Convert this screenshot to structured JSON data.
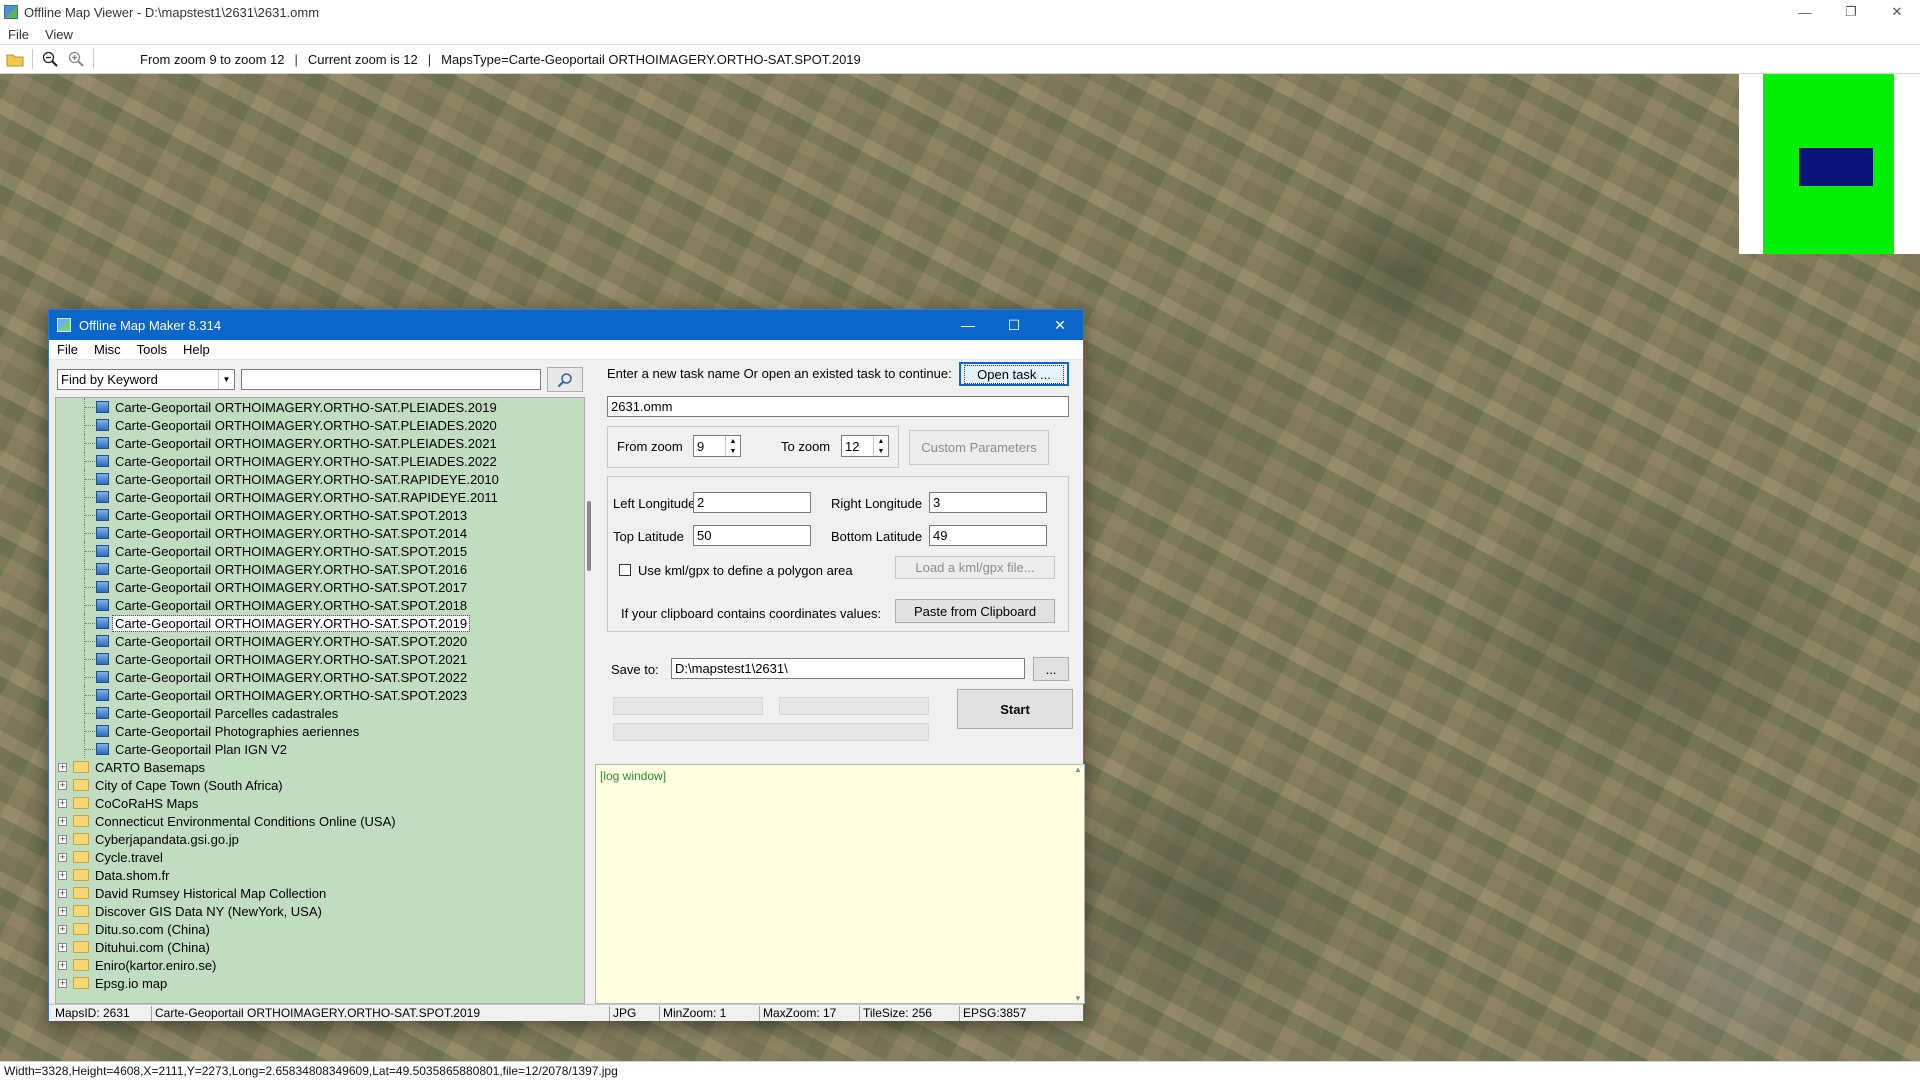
{
  "main_window": {
    "title": "Offline Map Viewer - D:\\mapstest1\\2631\\2631.omm",
    "menu": [
      "File",
      "View"
    ],
    "toolbar": {
      "zoom_range": "From zoom 9 to zoom 12",
      "current_zoom": "Current zoom is 12",
      "maps_type": "MapsType=Carte-Geoportail ORTHOIMAGERY.ORTHO-SAT.SPOT.2019",
      "separator": "|"
    },
    "status_bar": "Width=3328,Height=4608,X=2111,Y=2273,Long=2.65834808349609,Lat=49.5035865880801,file=12/2078/1397.jpg",
    "minimap_colors": {
      "background": "#00ee00",
      "viewport": "#0a1478"
    }
  },
  "dialog": {
    "title": "Offline Map Maker 8.314",
    "menu": [
      "File",
      "Misc",
      "Tools",
      "Help"
    ],
    "search_mode": "Find by Keyword",
    "search_value": "",
    "tree_children": [
      "Carte-Geoportail ORTHOIMAGERY.ORTHO-SAT.PLEIADES.2019",
      "Carte-Geoportail ORTHOIMAGERY.ORTHO-SAT.PLEIADES.2020",
      "Carte-Geoportail ORTHOIMAGERY.ORTHO-SAT.PLEIADES.2021",
      "Carte-Geoportail ORTHOIMAGERY.ORTHO-SAT.PLEIADES.2022",
      "Carte-Geoportail ORTHOIMAGERY.ORTHO-SAT.RAPIDEYE.2010",
      "Carte-Geoportail ORTHOIMAGERY.ORTHO-SAT.RAPIDEYE.2011",
      "Carte-Geoportail ORTHOIMAGERY.ORTHO-SAT.SPOT.2013",
      "Carte-Geoportail ORTHOIMAGERY.ORTHO-SAT.SPOT.2014",
      "Carte-Geoportail ORTHOIMAGERY.ORTHO-SAT.SPOT.2015",
      "Carte-Geoportail ORTHOIMAGERY.ORTHO-SAT.SPOT.2016",
      "Carte-Geoportail ORTHOIMAGERY.ORTHO-SAT.SPOT.2017",
      "Carte-Geoportail ORTHOIMAGERY.ORTHO-SAT.SPOT.2018",
      "Carte-Geoportail ORTHOIMAGERY.ORTHO-SAT.SPOT.2019",
      "Carte-Geoportail ORTHOIMAGERY.ORTHO-SAT.SPOT.2020",
      "Carte-Geoportail ORTHOIMAGERY.ORTHO-SAT.SPOT.2021",
      "Carte-Geoportail ORTHOIMAGERY.ORTHO-SAT.SPOT.2022",
      "Carte-Geoportail ORTHOIMAGERY.ORTHO-SAT.SPOT.2023",
      "Carte-Geoportail Parcelles cadastrales",
      "Carte-Geoportail Photographies aeriennes",
      "Carte-Geoportail Plan IGN V2"
    ],
    "selected_child": "Carte-Geoportail ORTHOIMAGERY.ORTHO-SAT.SPOT.2019",
    "tree_groups": [
      "CARTO Basemaps",
      "City of Cape Town (South Africa)",
      "CoCoRaHS Maps",
      "Connecticut Environmental Conditions Online (USA)",
      "Cyberjapandata.gsi.go.jp",
      "Cycle.travel",
      "Data.shom.fr",
      "David Rumsey Historical Map Collection",
      "Discover GIS Data NY (NewYork, USA)",
      "Ditu.so.com (China)",
      "Dituhui.com (China)",
      "Eniro(kartor.eniro.se)",
      "Epsg.io map"
    ],
    "task_prompt": "Enter a new task name Or open an existed task to continue:",
    "open_task_label": "Open task ...",
    "task_name": "2631.omm",
    "from_zoom_label": "From zoom",
    "from_zoom_value": "9",
    "to_zoom_label": "To zoom",
    "to_zoom_value": "12",
    "custom_params_label": "Custom Parameters",
    "left_lon_label": "Left Longitude",
    "left_lon_value": "2",
    "right_lon_label": "Right Longitude",
    "right_lon_value": "3",
    "top_lat_label": "Top Latitude",
    "top_lat_value": "50",
    "bottom_lat_label": "Bottom Latitude",
    "bottom_lat_value": "49",
    "kml_label": "Use kml/gpx to define a polygon area",
    "kml_checked": false,
    "load_kml_label": "Load a kml/gpx file...",
    "clipboard_label": "If your clipboard contains coordinates values:",
    "paste_label": "Paste from Clipboard",
    "save_to_label": "Save to:",
    "save_to_value": "D:\\mapstest1\\2631\\",
    "browse_label": "...",
    "start_label": "Start",
    "log_text": "[log window]",
    "status": {
      "maps_id": "MapsID: 2631",
      "maps_name": "Carte-Geoportail ORTHOIMAGERY.ORTHO-SAT.SPOT.2019",
      "format": "JPG",
      "min_zoom": "MinZoom: 1",
      "max_zoom": "MaxZoom: 17",
      "tile_size": "TileSize: 256",
      "epsg": "EPSG:3857"
    }
  }
}
